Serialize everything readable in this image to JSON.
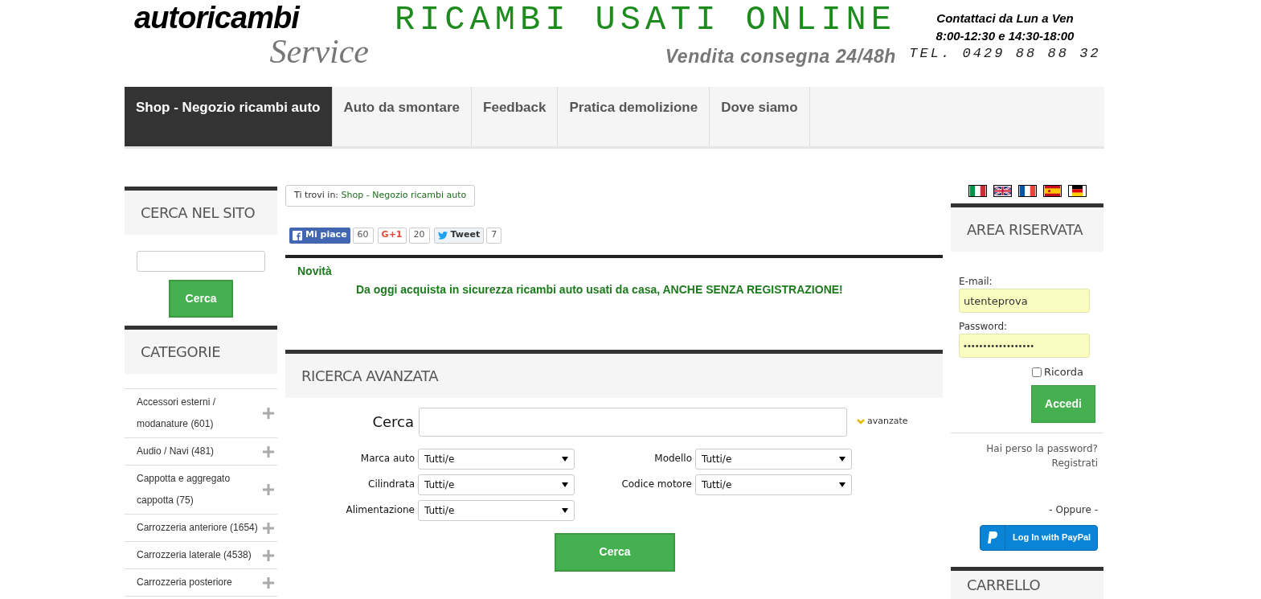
{
  "header": {
    "logo_top": "autoricambi",
    "logo_bottom": "Service",
    "headline": "RICAMBI USATI ONLINE",
    "tagline": "Vendita consegna 24/48h",
    "contact": [
      "Contattaci da Lun a Ven",
      "8:00-12:30 e 14:30-18:00",
      "TEL. 0429 88 88 32"
    ]
  },
  "nav": [
    {
      "label": "Shop - Negozio ricambi auto",
      "selected": true
    },
    {
      "label": "Auto da smontare",
      "selected": false
    },
    {
      "label": "Feedback",
      "selected": false
    },
    {
      "label": "Pratica demolizione",
      "selected": false
    },
    {
      "label": "Dove siamo",
      "selected": false
    }
  ],
  "left": {
    "search_title": "CERCA NEL SITO",
    "search_button": "Cerca",
    "categories_title": "CATEGORIE",
    "categories": [
      "Accessori esterni / modanature (601)",
      "Audio / Navi (481)",
      "Cappotta e aggregato cappotta (75)",
      "Carrozzeria anteriore (1654)",
      "Carrozzeria laterale (4538)",
      "Carrozzeria posteriore"
    ]
  },
  "breadcrumb": {
    "label": "Ti trovi in:",
    "link": "Shop - Negozio ricambi auto"
  },
  "social": [
    {
      "kind": "facebook",
      "label": "Mi piace",
      "count": "60"
    },
    {
      "kind": "gplus",
      "label": "G+1",
      "count": "20"
    },
    {
      "kind": "twitter",
      "label": "Tweet",
      "count": "7"
    }
  ],
  "news": {
    "title": "Novità",
    "text": "Da oggi acquista in sicurezza ricambi auto usati da casa, ANCHE SENZA REGISTRAZIONE!"
  },
  "advanced": {
    "title": "RICERCA AVANZATA",
    "search_label": "Cerca",
    "advanced_link": "avanzate",
    "filters": [
      [
        {
          "label": "Marca auto",
          "value": "Tutti/e"
        },
        {
          "label": "Modello",
          "value": "Tutti/e"
        }
      ],
      [
        {
          "label": "Cilindrata",
          "value": "Tutti/e"
        },
        {
          "label": "Codice motore",
          "value": "Tutti/e"
        }
      ],
      [
        {
          "label": "Alimentazione",
          "value": "Tutti/e"
        }
      ]
    ],
    "button": "Cerca"
  },
  "login": {
    "title": "AREA RISERVATA",
    "email_label": "E-mail:",
    "email": "utenteprova",
    "password_label": "Password:",
    "password": "••••••••••••••••••",
    "remember": {
      "label": "Ricorda",
      "checked": false
    },
    "button": "Accedi",
    "lost": "Hai perso la password?",
    "register": "Registrati",
    "or": "- Oppure -",
    "paypal": "Log In with PayPal"
  },
  "cart": {
    "title": "CARRELLO"
  }
}
